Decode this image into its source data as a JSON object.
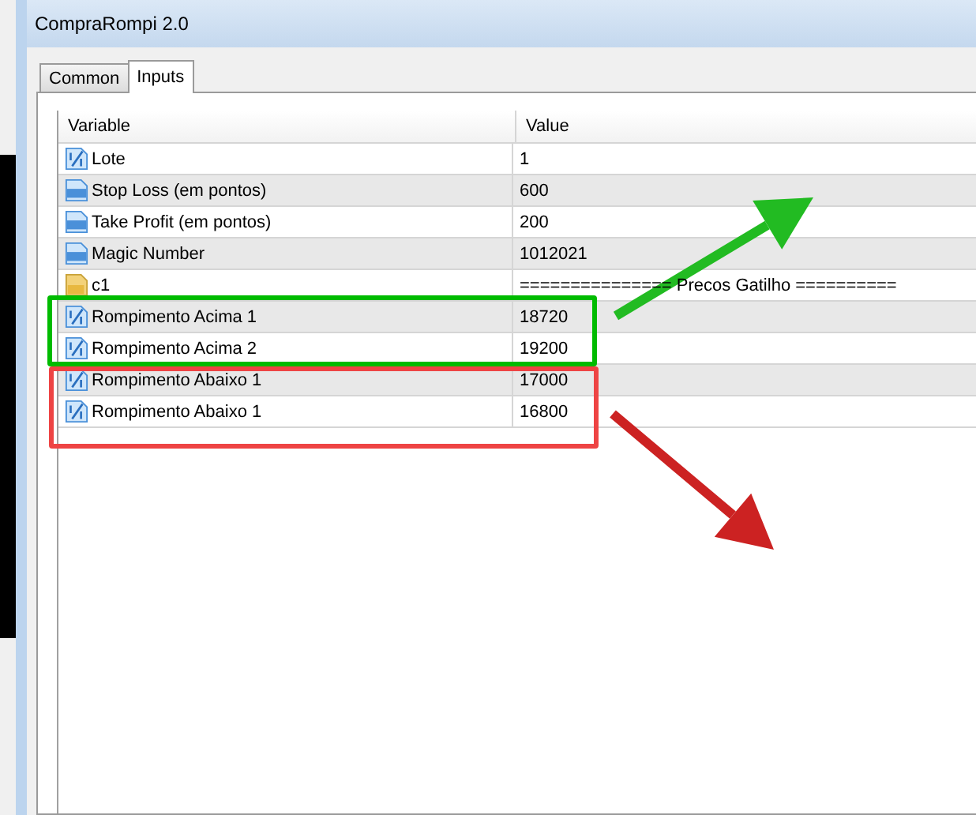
{
  "window": {
    "title": "CompraRompi 2.0"
  },
  "tabs": [
    {
      "label": "Common",
      "selected": false
    },
    {
      "label": "Inputs",
      "selected": true
    }
  ],
  "table": {
    "columns": [
      "Variable",
      "Value"
    ],
    "rows": [
      {
        "kind": "double",
        "variable": "Lote",
        "value": "1"
      },
      {
        "kind": "integer",
        "variable": "Stop Loss (em pontos)",
        "value": "600"
      },
      {
        "kind": "integer",
        "variable": "Take Profit (em pontos)",
        "value": "200"
      },
      {
        "kind": "integer",
        "variable": "Magic Number",
        "value": "1012021"
      },
      {
        "kind": "string",
        "variable": "c1",
        "value": "=============== Precos Gatilho =========="
      },
      {
        "kind": "double",
        "variable": "Rompimento Acima 1",
        "value": "18720"
      },
      {
        "kind": "double",
        "variable": "Rompimento Acima 2",
        "value": "19200"
      },
      {
        "kind": "double",
        "variable": "Rompimento Abaixo 1",
        "value": "17000"
      },
      {
        "kind": "double",
        "variable": "Rompimento Abaixo 1",
        "value": "16800"
      }
    ]
  },
  "annotations": [
    {
      "kind": "box",
      "color": "#00bb00"
    },
    {
      "kind": "box",
      "color": "#ee4444"
    },
    {
      "kind": "arrow",
      "color": "#22bb22"
    },
    {
      "kind": "arrow",
      "color": "#cc2222"
    }
  ]
}
